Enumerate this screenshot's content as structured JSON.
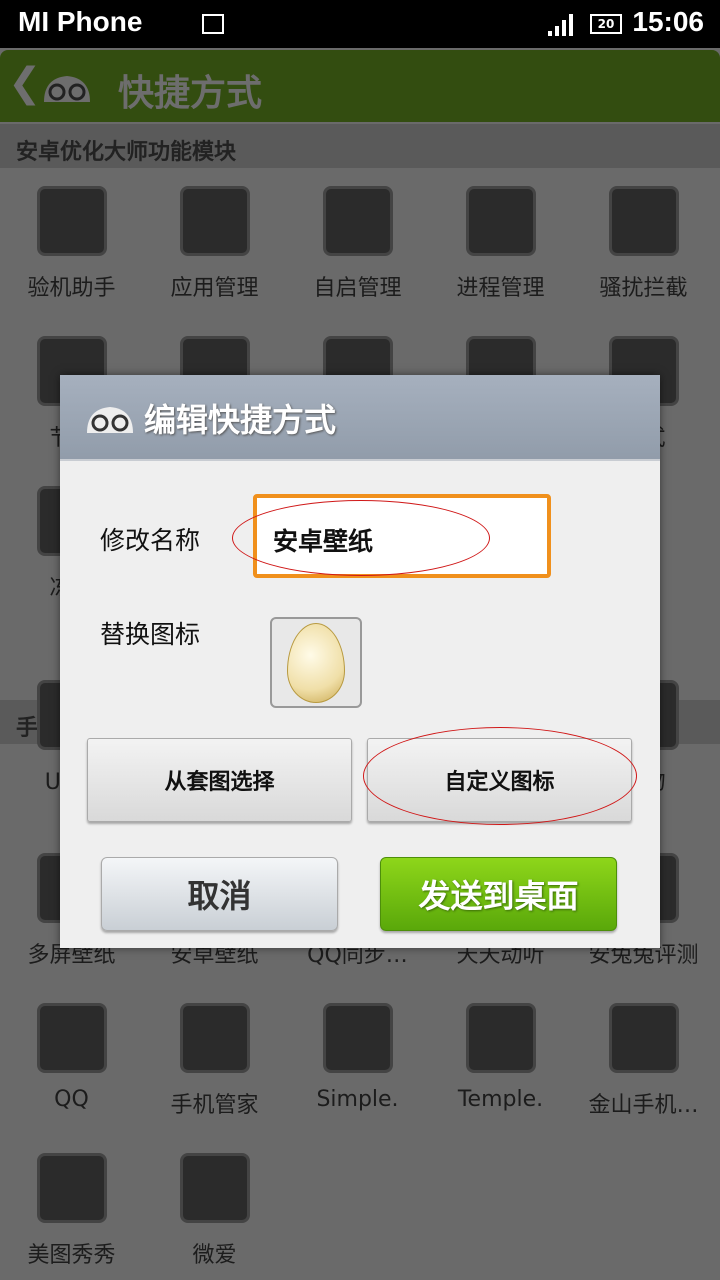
{
  "status_bar": {
    "carrier": "MI Phone",
    "time": "15:06",
    "battery": "20",
    "icons": [
      "gallery-notification-icon",
      "signal-icon",
      "battery-icon"
    ]
  },
  "action_bar": {
    "title": "快捷方式",
    "icons": [
      "back-icon",
      "app-logo-icon"
    ]
  },
  "section1": {
    "title": "安卓优化大师功能模块",
    "items": [
      {
        "label": "验机助手"
      },
      {
        "label": "应用管理"
      },
      {
        "label": "自启管理"
      },
      {
        "label": "进程管理"
      },
      {
        "label": "骚扰拦截"
      },
      {
        "label": "节电"
      },
      {
        "label": ""
      },
      {
        "label": ""
      },
      {
        "label": ""
      },
      {
        "label": "方式"
      },
      {
        "label": "冻结"
      }
    ]
  },
  "section2": {
    "title": "手机",
    "items": [
      {
        "label": "UC浏"
      },
      {
        "label": ""
      },
      {
        "label": ""
      },
      {
        "label": ""
      },
      {
        "label": "购物"
      },
      {
        "label": "多屏壁纸"
      },
      {
        "label": "安卓壁纸"
      },
      {
        "label": "QQ同步…"
      },
      {
        "label": "天天动听"
      },
      {
        "label": "安兔兔评测"
      },
      {
        "label": "QQ"
      },
      {
        "label": "手机管家"
      },
      {
        "label": "Simple."
      },
      {
        "label": "Temple."
      },
      {
        "label": "金山手机…"
      },
      {
        "label": "美图秀秀"
      },
      {
        "label": "微爱"
      }
    ]
  },
  "dialog": {
    "title": "编辑快捷方式",
    "name_label": "修改名称",
    "name_value": "安卓壁纸",
    "icon_label": "替换图标",
    "icon": "egg-icon",
    "from_set_button": "从套图选择",
    "custom_icon_button": "自定义图标",
    "cancel_button": "取消",
    "send_button": "发送到桌面"
  },
  "colors": {
    "accent_orange": "#f0901c",
    "send_green": "#6cbc10",
    "annotation_red": "#d01818"
  }
}
